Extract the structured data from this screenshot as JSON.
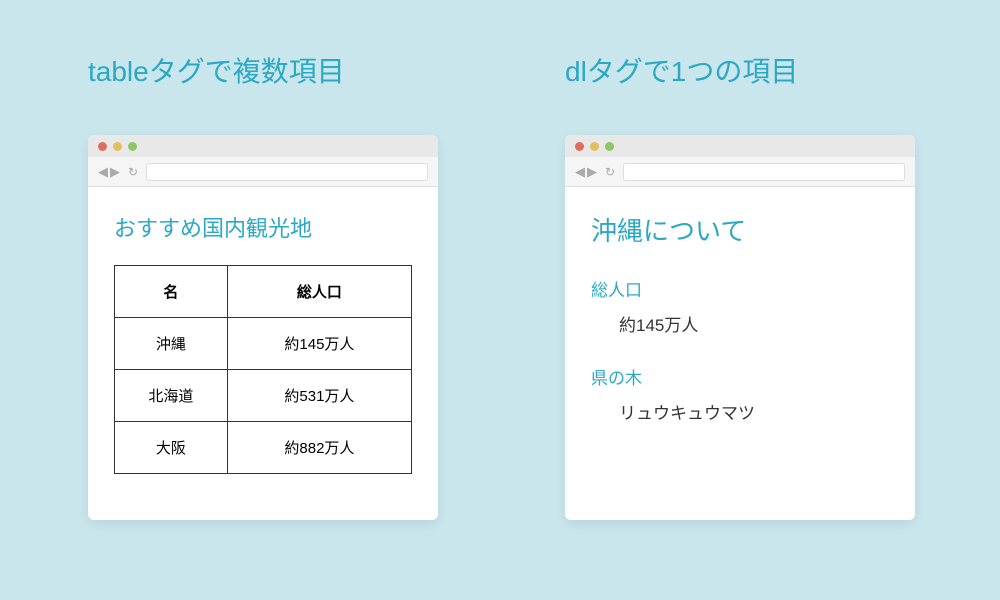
{
  "left": {
    "section_title": "tableタグで複数項目",
    "page_title": "おすすめ国内観光地",
    "table": {
      "headers": [
        "名",
        "総人口"
      ],
      "rows": [
        [
          "沖縄",
          "約145万人"
        ],
        [
          "北海道",
          "約531万人"
        ],
        [
          "大阪",
          "約882万人"
        ]
      ]
    }
  },
  "right": {
    "section_title": "dlタグで1つの項目",
    "page_title": "沖縄について",
    "items": [
      {
        "term": "総人口",
        "def": "約145万人"
      },
      {
        "term": "県の木",
        "def": "リュウキュウマツ"
      }
    ]
  },
  "colors": {
    "accent": "#2ba8c4",
    "bg": "#c9e6ed"
  }
}
